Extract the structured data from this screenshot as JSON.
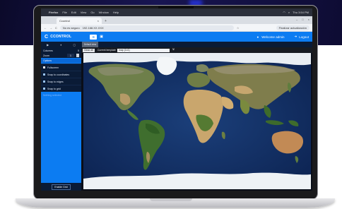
{
  "menubar": {
    "apple": "",
    "items": [
      "Firefox",
      "File",
      "Edit",
      "View",
      "Go",
      "Window",
      "Help"
    ],
    "right": [
      "Thu 3:54 PM"
    ]
  },
  "browser": {
    "tab_title": "Ccontrol",
    "new_tab": "+",
    "window_controls": [
      "–",
      "□",
      "×"
    ],
    "nav": [
      "←",
      "→",
      "C"
    ],
    "url_security": "No es seguro",
    "url": "192.168.XX.XXX",
    "profile": "Finalizar actualización"
  },
  "app": {
    "logo_mark": "C",
    "logo_text": "CCONTROL",
    "header_btn1": "⊞",
    "header_btn2": "▣",
    "welcome": "Welcome admin",
    "logout": "Logout"
  },
  "sidebar": {
    "tools": [
      "▶",
      "⏸",
      "◻"
    ],
    "columns_label": "Columns",
    "columns_value": "5",
    "zoom_label": "Zoom",
    "zoom_value": "1",
    "section_label": "Options",
    "options": [
      {
        "label": "Fullscreen",
        "checked": false
      },
      {
        "label": "Snap to coordinates",
        "checked": true
      },
      {
        "label": "Snap to edges",
        "checked": true
      },
      {
        "label": "Snap to grid",
        "checked": true
      }
    ],
    "hint": "Nothing selected",
    "enable_button": "Enable Grid"
  },
  "main": {
    "tab": "Default view",
    "clear_button": "Clear all",
    "template_label": "Current template",
    "template_value": "map (1x1)",
    "template_icon": "🖫"
  },
  "colors": {
    "accent": "#0c7cf2",
    "dark_panel": "#0a1b36",
    "ocean": "#102b5e"
  }
}
